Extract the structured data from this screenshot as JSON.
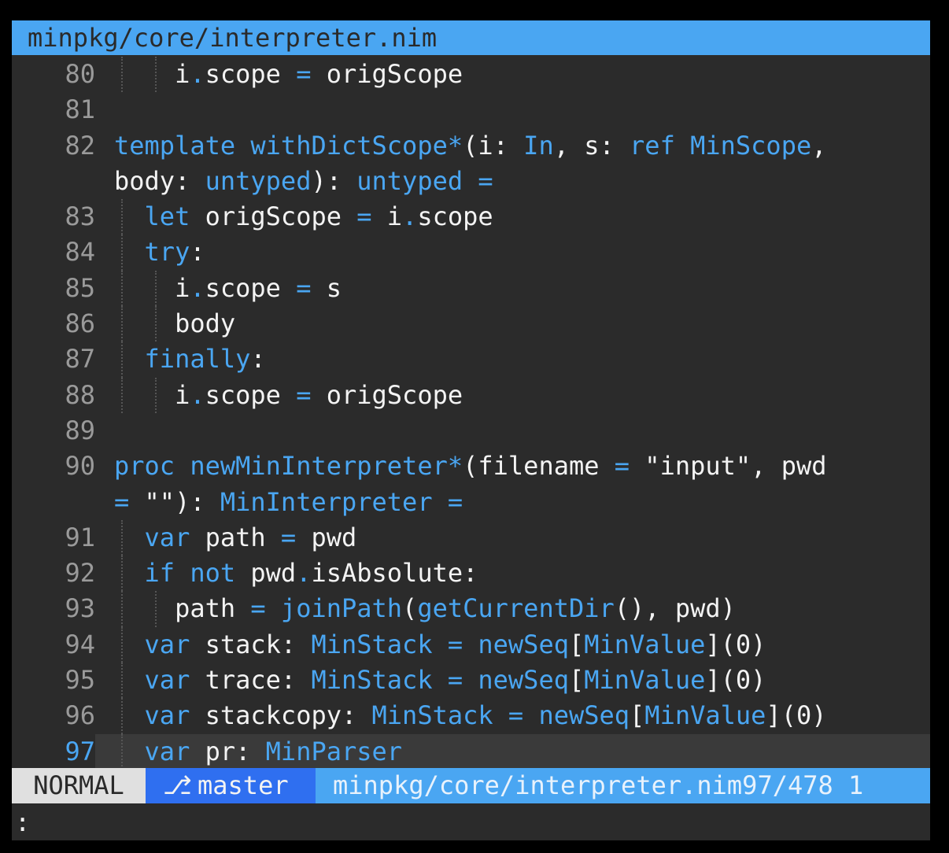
{
  "tabline": {
    "filename": "minpkg/core/interpreter.nim"
  },
  "lines": [
    {
      "n": "80",
      "guides": [
        1,
        2
      ],
      "tokens": [
        [
          "",
          "    "
        ],
        [
          "",
          "i"
        ],
        [
          "op",
          "."
        ],
        [
          "",
          "scope "
        ],
        [
          "op",
          "="
        ],
        [
          "",
          " origScope"
        ]
      ]
    },
    {
      "n": "81",
      "guides": [],
      "tokens": []
    },
    {
      "n": "82",
      "guides": [],
      "tokens": [
        [
          "kw",
          "template"
        ],
        [
          "",
          " "
        ],
        [
          "fn",
          "withDictScope"
        ],
        [
          "op",
          "*"
        ],
        [
          "",
          "(i: "
        ],
        [
          "ty",
          "In"
        ],
        [
          "",
          ", s: "
        ],
        [
          "kw",
          "ref"
        ],
        [
          "",
          " "
        ],
        [
          "ty",
          "MinScope"
        ],
        [
          "",
          ","
        ]
      ]
    },
    {
      "n": "",
      "guides": [],
      "tokens": [
        [
          "",
          "body: "
        ],
        [
          "ty",
          "untyped"
        ],
        [
          "",
          "): "
        ],
        [
          "ty",
          "untyped"
        ],
        [
          "",
          " "
        ],
        [
          "op",
          "="
        ]
      ]
    },
    {
      "n": "83",
      "guides": [
        1
      ],
      "tokens": [
        [
          "",
          "  "
        ],
        [
          "kw",
          "let"
        ],
        [
          "",
          " origScope "
        ],
        [
          "op",
          "="
        ],
        [
          "",
          " i"
        ],
        [
          "op",
          "."
        ],
        [
          "",
          "scope"
        ]
      ]
    },
    {
      "n": "84",
      "guides": [
        1
      ],
      "tokens": [
        [
          "",
          "  "
        ],
        [
          "kw",
          "try"
        ],
        [
          "",
          ":"
        ]
      ]
    },
    {
      "n": "85",
      "guides": [
        1,
        2
      ],
      "tokens": [
        [
          "",
          "    i"
        ],
        [
          "op",
          "."
        ],
        [
          "",
          "scope "
        ],
        [
          "op",
          "="
        ],
        [
          "",
          " s"
        ]
      ]
    },
    {
      "n": "86",
      "guides": [
        1,
        2
      ],
      "tokens": [
        [
          "",
          "    body"
        ]
      ]
    },
    {
      "n": "87",
      "guides": [
        1
      ],
      "tokens": [
        [
          "",
          "  "
        ],
        [
          "kw",
          "finally"
        ],
        [
          "",
          ":"
        ]
      ]
    },
    {
      "n": "88",
      "guides": [
        1,
        2
      ],
      "tokens": [
        [
          "",
          "    i"
        ],
        [
          "op",
          "."
        ],
        [
          "",
          "scope "
        ],
        [
          "op",
          "="
        ],
        [
          "",
          " origScope"
        ]
      ]
    },
    {
      "n": "89",
      "guides": [],
      "tokens": []
    },
    {
      "n": "90",
      "guides": [],
      "tokens": [
        [
          "kw",
          "proc"
        ],
        [
          "",
          " "
        ],
        [
          "fn",
          "newMinInterpreter"
        ],
        [
          "op",
          "*"
        ],
        [
          "",
          "(filename "
        ],
        [
          "op",
          "="
        ],
        [
          "",
          " \"input\", pwd"
        ]
      ]
    },
    {
      "n": "",
      "guides": [],
      "tokens": [
        [
          "op",
          "="
        ],
        [
          "",
          " \"\"): "
        ],
        [
          "ty",
          "MinInterpreter"
        ],
        [
          "",
          " "
        ],
        [
          "op",
          "="
        ]
      ]
    },
    {
      "n": "91",
      "guides": [
        1
      ],
      "tokens": [
        [
          "",
          "  "
        ],
        [
          "kw",
          "var"
        ],
        [
          "",
          " path "
        ],
        [
          "op",
          "="
        ],
        [
          "",
          " pwd"
        ]
      ]
    },
    {
      "n": "92",
      "guides": [
        1
      ],
      "tokens": [
        [
          "",
          "  "
        ],
        [
          "kw",
          "if"
        ],
        [
          "",
          " "
        ],
        [
          "kw",
          "not"
        ],
        [
          "",
          " pwd"
        ],
        [
          "op",
          "."
        ],
        [
          "",
          "isAbsolute:"
        ]
      ]
    },
    {
      "n": "93",
      "guides": [
        1,
        2
      ],
      "tokens": [
        [
          "",
          "    path "
        ],
        [
          "op",
          "="
        ],
        [
          "",
          " "
        ],
        [
          "fn",
          "joinPath"
        ],
        [
          "",
          "("
        ],
        [
          "fn",
          "getCurrentDir"
        ],
        [
          "",
          "(), pwd)"
        ]
      ]
    },
    {
      "n": "94",
      "guides": [
        1
      ],
      "tokens": [
        [
          "",
          "  "
        ],
        [
          "kw",
          "var"
        ],
        [
          "",
          " stack: "
        ],
        [
          "ty",
          "MinStack"
        ],
        [
          "",
          " "
        ],
        [
          "op",
          "="
        ],
        [
          "",
          " "
        ],
        [
          "fn",
          "newSeq"
        ],
        [
          "",
          "["
        ],
        [
          "ty",
          "MinValue"
        ],
        [
          "",
          "]("
        ],
        [
          "num",
          "0"
        ],
        [
          "",
          ")"
        ]
      ]
    },
    {
      "n": "95",
      "guides": [
        1
      ],
      "tokens": [
        [
          "",
          "  "
        ],
        [
          "kw",
          "var"
        ],
        [
          "",
          " trace: "
        ],
        [
          "ty",
          "MinStack"
        ],
        [
          "",
          " "
        ],
        [
          "op",
          "="
        ],
        [
          "",
          " "
        ],
        [
          "fn",
          "newSeq"
        ],
        [
          "",
          "["
        ],
        [
          "ty",
          "MinValue"
        ],
        [
          "",
          "]("
        ],
        [
          "num",
          "0"
        ],
        [
          "",
          ")"
        ]
      ]
    },
    {
      "n": "96",
      "guides": [
        1
      ],
      "tokens": [
        [
          "",
          "  "
        ],
        [
          "kw",
          "var"
        ],
        [
          "",
          " stackcopy: "
        ],
        [
          "ty",
          "MinStack"
        ],
        [
          "",
          " "
        ],
        [
          "op",
          "="
        ],
        [
          "",
          " "
        ],
        [
          "fn",
          "newSeq"
        ],
        [
          "",
          "["
        ],
        [
          "ty",
          "MinValue"
        ],
        [
          "",
          "]("
        ],
        [
          "num",
          "0"
        ],
        [
          "",
          ")"
        ]
      ]
    },
    {
      "n": "97",
      "guides": [
        1
      ],
      "current": true,
      "tokens": [
        [
          "",
          "  "
        ],
        [
          "kw",
          "var"
        ],
        [
          "",
          " pr: "
        ],
        [
          "ty",
          "MinParser"
        ]
      ]
    }
  ],
  "statusline": {
    "mode": "NORMAL",
    "branch_icon": "git-branch-icon",
    "branch_glyph": "⎇",
    "branch": "master",
    "fileinfo": "minpkg/core/interpreter.nim97/478 1"
  },
  "cmdline": {
    "text": ":"
  },
  "colors": {
    "background": "#2b2b2b",
    "accent": "#4aa6f2",
    "branch_bg": "#2f6ff0",
    "mode_bg": "#e0e0e0"
  }
}
